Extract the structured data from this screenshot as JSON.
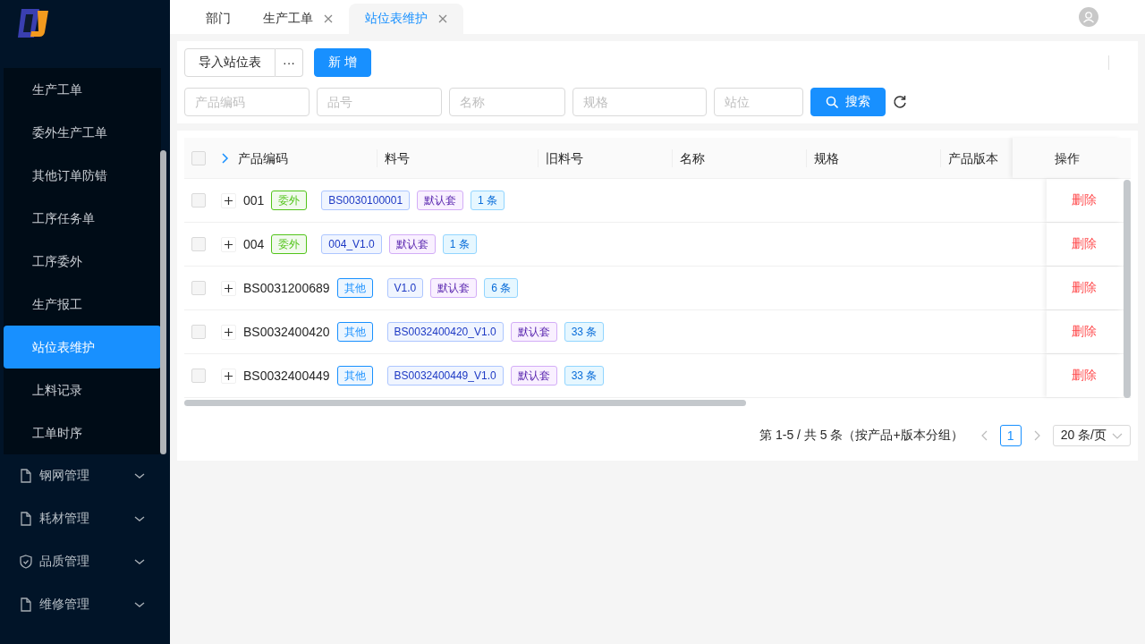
{
  "sidebar": {
    "submenu": [
      {
        "label": "生产工单",
        "selected": false
      },
      {
        "label": "委外生产工单",
        "selected": false
      },
      {
        "label": "其他订单防错",
        "selected": false
      },
      {
        "label": "工序任务单",
        "selected": false
      },
      {
        "label": "工序委外",
        "selected": false
      },
      {
        "label": "生产报工",
        "selected": false
      },
      {
        "label": "站位表维护",
        "selected": true
      },
      {
        "label": "上料记录",
        "selected": false
      },
      {
        "label": "工单时序",
        "selected": false
      }
    ],
    "groups": [
      {
        "label": "钢网管理",
        "kind": "file",
        "expanded": false
      },
      {
        "label": "耗材管理",
        "kind": "file",
        "expanded": false
      },
      {
        "label": "品质管理",
        "kind": "shield",
        "expanded": false
      },
      {
        "label": "维修管理",
        "kind": "file",
        "expanded": false
      }
    ]
  },
  "tabs": [
    {
      "label": "部门",
      "closable": false,
      "selected": false
    },
    {
      "label": "生产工单",
      "closable": true,
      "selected": false
    },
    {
      "label": "站位表维护",
      "closable": true,
      "selected": true
    }
  ],
  "toolbar": {
    "import_button": "导入站位表",
    "more_button": "···",
    "add_button": "新 增"
  },
  "filters": [
    {
      "placeholder": "产品编码"
    },
    {
      "placeholder": "品号"
    },
    {
      "placeholder": "名称"
    },
    {
      "placeholder": "规格"
    },
    {
      "placeholder": "站位"
    }
  ],
  "search_button": "搜索",
  "table": {
    "columns": [
      "产品编码",
      "料号",
      "旧料号",
      "名称",
      "规格",
      "产品版本",
      "操作"
    ],
    "all_checked": false,
    "rows": [
      {
        "checked": false,
        "code": "001",
        "tags": [
          {
            "text": "委外",
            "color": "#52c41a"
          },
          {
            "text": "BS0030100001",
            "kind": "part"
          },
          {
            "text": "默认套",
            "kind": "set"
          },
          {
            "text": "1 条",
            "kind": "count"
          }
        ],
        "action": "删除"
      },
      {
        "checked": false,
        "code": "004",
        "tags": [
          {
            "text": "委外",
            "color": "#52c41a"
          },
          {
            "text": "004_V1.0",
            "kind": "part"
          },
          {
            "text": "默认套",
            "kind": "set"
          },
          {
            "text": "1 条",
            "kind": "count"
          }
        ],
        "action": "删除"
      },
      {
        "checked": false,
        "code": "BS0031200689",
        "tags": [
          {
            "text": "其他",
            "color": "#1890ff"
          },
          {
            "text": "V1.0",
            "kind": "part"
          },
          {
            "text": "默认套",
            "kind": "set"
          },
          {
            "text": "6 条",
            "kind": "count"
          }
        ],
        "action": "删除"
      },
      {
        "checked": false,
        "code": "BS0032400420",
        "tags": [
          {
            "text": "其他",
            "color": "#1890ff"
          },
          {
            "text": "BS0032400420_V1.0",
            "kind": "part"
          },
          {
            "text": "默认套",
            "kind": "set"
          },
          {
            "text": "33 条",
            "kind": "count"
          }
        ],
        "action": "删除"
      },
      {
        "checked": false,
        "code": "BS0032400449",
        "tags": [
          {
            "text": "其他",
            "color": "#1890ff"
          },
          {
            "text": "BS0032400449_V1.0",
            "kind": "part"
          },
          {
            "text": "默认套",
            "kind": "set"
          },
          {
            "text": "33 条",
            "kind": "count"
          }
        ],
        "action": "删除"
      }
    ]
  },
  "pagination": {
    "summary": "第 1-5 / 共 5 条（按产品+版本分组）",
    "pages": [
      {
        "label": "1",
        "selected": true
      }
    ],
    "page_size": "20 条/页"
  }
}
